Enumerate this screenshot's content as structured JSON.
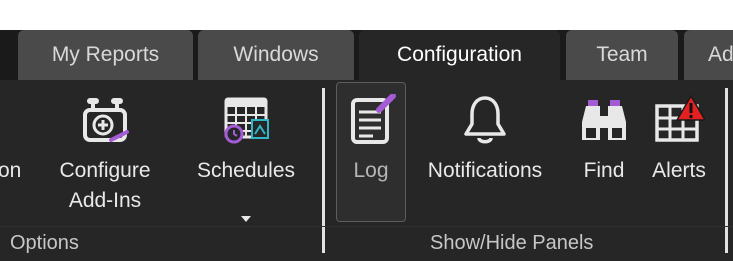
{
  "tabs": [
    {
      "label": "My Reports",
      "active": false
    },
    {
      "label": "Windows",
      "active": false
    },
    {
      "label": "Configuration",
      "active": true
    },
    {
      "label": "Team",
      "active": false
    },
    {
      "label": "Ad",
      "active": false
    }
  ],
  "ribbon": {
    "groups": {
      "options": {
        "label": "Options",
        "clipped_command_label": "on",
        "commands": {
          "configure_addins": {
            "line1": "Configure",
            "line2": "Add-Ins",
            "icon": "add-ins-icon"
          },
          "schedules": {
            "label": "Schedules",
            "icon": "schedule-calendar-icon",
            "dropdown": "chevron-down-icon"
          }
        }
      },
      "show_hide_panels": {
        "label": "Show/Hide Panels",
        "commands": {
          "log": {
            "label": "Log",
            "icon": "log-notepad-icon",
            "pressed": true
          },
          "notifications": {
            "label": "Notifications",
            "icon": "bell-icon"
          },
          "find": {
            "label": "Find",
            "icon": "binoculars-icon"
          },
          "alerts": {
            "label": "Alerts",
            "icon": "alert-table-icon"
          }
        }
      }
    }
  },
  "colors": {
    "background": "#1a1a1a",
    "ribbon": "#262626",
    "tab_inactive": "#4a4a4a",
    "accent_purple": "#a45bd6",
    "alert_red": "#e52020"
  }
}
